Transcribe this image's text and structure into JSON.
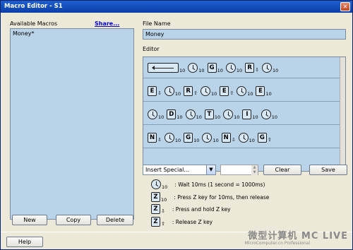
{
  "window": {
    "title": "Macro Editor - S1"
  },
  "left": {
    "label": "Available Macros",
    "share_link": "Share...",
    "items": [
      "Money*"
    ],
    "buttons": {
      "new": "New",
      "copy": "Copy",
      "delete": "Delete"
    }
  },
  "right": {
    "file_name_label": "File Name",
    "file_name_value": "Money",
    "editor_label": "Editor",
    "rows": [
      [
        {
          "t": "enter",
          "n": "10"
        },
        {
          "t": "wait",
          "n": "10"
        },
        {
          "t": "key",
          "k": "G",
          "n": "10"
        },
        {
          "t": "wait",
          "n": "10"
        },
        {
          "t": "keydown",
          "k": "R"
        },
        {
          "t": "wait",
          "n": "10"
        }
      ],
      [
        {
          "t": "keydown",
          "k": "E"
        },
        {
          "t": "wait",
          "n": "10"
        },
        {
          "t": "keyup",
          "k": "R"
        },
        {
          "t": "wait",
          "n": "10"
        },
        {
          "t": "keyup",
          "k": "E"
        },
        {
          "t": "wait",
          "n": "10"
        },
        {
          "t": "key",
          "k": "E",
          "n": "10"
        }
      ],
      [
        {
          "t": "wait",
          "n": "10"
        },
        {
          "t": "key",
          "k": "D",
          "n": "10"
        },
        {
          "t": "wait",
          "n": "10"
        },
        {
          "t": "key",
          "k": "T",
          "n": "10"
        },
        {
          "t": "wait",
          "n": "10"
        },
        {
          "t": "key",
          "k": "I",
          "n": "10"
        },
        {
          "t": "wait",
          "n": "10"
        }
      ],
      [
        {
          "t": "keydown",
          "k": "N"
        },
        {
          "t": "wait",
          "n": "10"
        },
        {
          "t": "key",
          "k": "G",
          "n": "10"
        },
        {
          "t": "wait",
          "n": "10"
        },
        {
          "t": "keydown",
          "k": "N"
        },
        {
          "t": "wait",
          "n": "10"
        },
        {
          "t": "keyup",
          "k": "G"
        }
      ]
    ],
    "insert_special": "Insert Special...",
    "clear_button": "Clear",
    "save_button": "Save",
    "legend": [
      {
        "t": "wait",
        "n": "10",
        "text": ": Wait 10ms (1 second = 1000ms)"
      },
      {
        "t": "key",
        "k": "Z",
        "n": "10",
        "text": ": Press Z key for 10ms, then release"
      },
      {
        "t": "keydown",
        "k": "Z",
        "text": ": Press and hold Z key"
      },
      {
        "t": "keyup",
        "k": "Z",
        "text": ": Release Z key"
      }
    ]
  },
  "help_button": "Help",
  "watermark": {
    "brand": "微型计算机 MC LIVE",
    "sub": "MicroComputer.cn Professional"
  },
  "icons": {
    "close": "close-icon",
    "dropdown": "chevron-down-icon",
    "wait": "clock-icon",
    "hold": "arrow-down-icon",
    "release": "arrow-up-icon",
    "enter": "enter-key-icon"
  }
}
